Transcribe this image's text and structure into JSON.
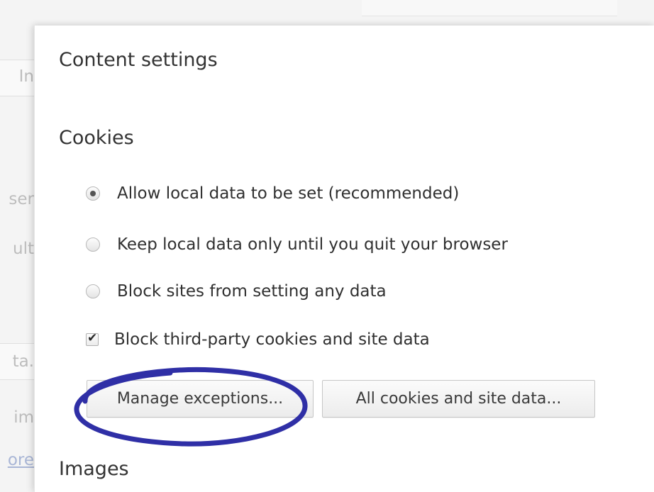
{
  "background": {
    "fragments": [
      "In",
      "ser",
      "ult",
      "ta.",
      "im",
      "ore"
    ]
  },
  "dialog": {
    "title": "Content settings",
    "cookies": {
      "heading": "Cookies",
      "options": [
        {
          "label": "Allow local data to be set (recommended)",
          "checked": true
        },
        {
          "label": "Keep local data only until you quit your browser",
          "checked": false
        },
        {
          "label": "Block sites from setting any data",
          "checked": false
        }
      ],
      "third_party": {
        "label": "Block third-party cookies and site data",
        "checked": true
      },
      "manage_exceptions_label": "Manage exceptions...",
      "all_cookies_label": "All cookies and site data..."
    },
    "images": {
      "heading": "Images"
    }
  },
  "colors": {
    "annotation_ring": "#2f2fa6",
    "link": "#a9b6d6"
  }
}
